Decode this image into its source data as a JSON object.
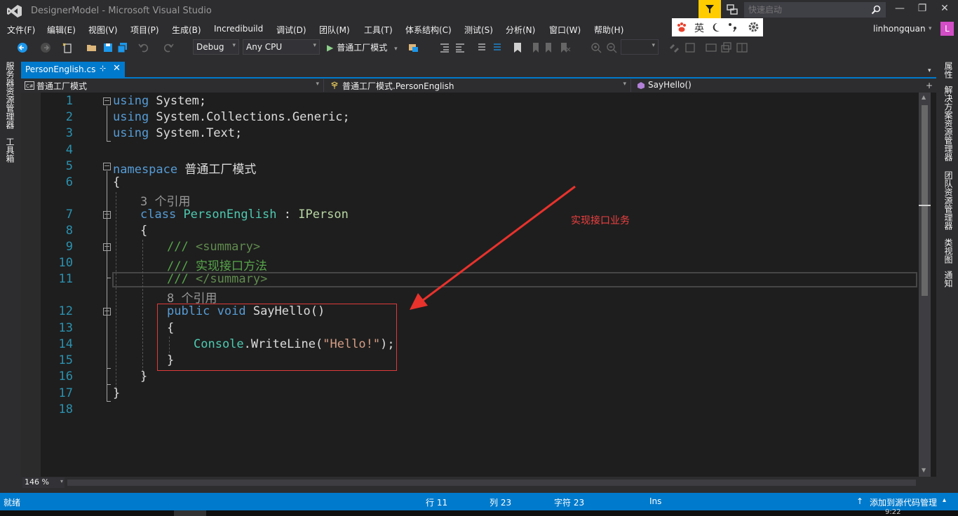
{
  "window": {
    "title": "DesignerModel - Microsoft Visual Studio",
    "quick_launch_placeholder": "快速启动",
    "minimize": "—",
    "restore": "❐",
    "close": "✕"
  },
  "menu": [
    "文件(F)",
    "编辑(E)",
    "视图(V)",
    "项目(P)",
    "生成(B)",
    "Incredibuild",
    "调试(D)",
    "团队(M)",
    "工具(T)",
    "体系结构(C)",
    "测试(S)",
    "分析(N)",
    "窗口(W)",
    "帮助(H)"
  ],
  "ime": {
    "language": "英"
  },
  "account": {
    "user": "linhongquan",
    "avatar_letter": "L"
  },
  "toolbar": {
    "config": "Debug",
    "platform": "Any CPU",
    "start_label": "普通工厂模式",
    "chev": "▾"
  },
  "left_panel_tabs": [
    "服务器资源管理器",
    "工具箱"
  ],
  "right_panel_tabs": [
    "属性",
    "解决方案资源管理器",
    "团队资源管理器",
    "类视图",
    "通知"
  ],
  "document_tab": {
    "title": "PersonEnglish.cs",
    "pin": "⊹",
    "close": "✕"
  },
  "navigation": {
    "project": "普通工厂模式",
    "type": "普通工厂模式.PersonEnglish",
    "member": "SayHello()"
  },
  "editor": {
    "line_numbers": [
      "1",
      "2",
      "3",
      "4",
      "5",
      "6",
      "7",
      "8",
      "9",
      "10",
      "11",
      "12",
      "13",
      "14",
      "15",
      "16",
      "17",
      "18"
    ],
    "code": {
      "l1_kw": "using",
      "l1_rest": " System;",
      "l2_kw": "using",
      "l2_rest": " System.Collections.Generic;",
      "l3_kw": "using",
      "l3_rest": " System.Text;",
      "l5_kw": "namespace",
      "l5_rest": " 普通工厂模式",
      "l6": "{",
      "ref1": "3 个引用",
      "l7_kw": "class",
      "l7_type": "PersonEnglish",
      "l7_colon": " : ",
      "l7_iface": "IPerson",
      "l8": "{",
      "l9_slash": "/// ",
      "l9_tag": "<summary>",
      "l10_slash": "/// ",
      "l10_text": "实现接口方法",
      "l11_slash": "/// ",
      "l11_tag": "</summary>",
      "ref2": "8 个引用",
      "l12_kw": "public void",
      "l12_rest": " SayHello()",
      "l13": "{",
      "l14_type": "Console",
      "l14_mid": ".WriteLine(",
      "l14_str": "\"Hello!\"",
      "l14_end": ");",
      "l15": "}",
      "l16": "}",
      "l17": "}"
    },
    "fold_symbol": "−",
    "annotation": "实现接口业务"
  },
  "zoom": "146 %",
  "status": {
    "state": "就绪",
    "line": "行 11",
    "col": "列 23",
    "char": "字符 23",
    "mode": "Ins",
    "source_control": "添加到源代码管理",
    "source_control_arrow": "↑",
    "source_control_chev": "▴"
  },
  "taskbar": {
    "clock": "9:22"
  },
  "colors": {
    "accent": "#007acc",
    "keyword": "#569cd6",
    "type": "#4ec9b0",
    "comment": "#57a64a",
    "string": "#d69d85",
    "annotation": "#e03a3a"
  }
}
